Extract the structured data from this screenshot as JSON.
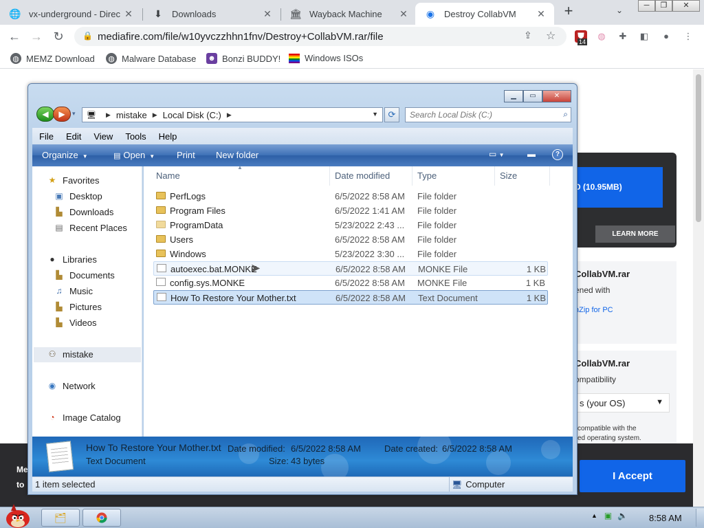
{
  "browser": {
    "tabs": [
      {
        "label": "vx-underground - Direc",
        "icon": "globe-icon",
        "active": false
      },
      {
        "label": "Downloads",
        "icon": "download-icon",
        "active": false
      },
      {
        "label": "Wayback Machine",
        "icon": "archive-icon",
        "active": false
      },
      {
        "label": "Destroy CollabVM",
        "icon": "collabvm-icon",
        "active": true
      }
    ],
    "url": "mediafire.com/file/w10yvczzhhn1fnv/Destroy+CollabVM.rar/file",
    "extension_badge": "14",
    "bookmarks": [
      {
        "label": "MEMZ Download",
        "icon": "globe-icon"
      },
      {
        "label": "Malware Database",
        "icon": "globe-icon"
      },
      {
        "label": "Bonzi BUDDY!",
        "icon": "bonzi-icon"
      },
      {
        "label": "Windows ISOs",
        "icon": "rainbow-flag-icon"
      }
    ]
  },
  "webpage": {
    "download_button": "D (10.95MB)",
    "learn_more": "LEARN MORE",
    "box1_title": "CollabVM.rar",
    "box1_line": "ened with",
    "box1_link": "nZip for PC",
    "box2_title": "CollabVM.rar",
    "box2_line": "ompatibility",
    "os_select": "s (your OS)",
    "compat_note_1": "compatible with the",
    "compat_note_2": "ed operating system.",
    "cookie_text_1": "Me",
    "cookie_text_2": "to",
    "accept": "I Accept"
  },
  "explorer": {
    "breadcrumb": [
      "mistake",
      "Local Disk (C:)"
    ],
    "search_placeholder": "Search Local Disk (C:)",
    "menu": [
      "File",
      "Edit",
      "View",
      "Tools",
      "Help"
    ],
    "commands": {
      "organize": "Organize",
      "open": "Open",
      "print": "Print",
      "new_folder": "New folder"
    },
    "nav": {
      "favorites": "Favorites",
      "favorites_items": [
        "Desktop",
        "Downloads",
        "Recent Places"
      ],
      "libraries": "Libraries",
      "libraries_items": [
        "Documents",
        "Music",
        "Pictures",
        "Videos"
      ],
      "homegroup": "mistake",
      "network": "Network",
      "image_catalog": "Image Catalog"
    },
    "columns": {
      "name": "Name",
      "date": "Date modified",
      "type": "Type",
      "size": "Size"
    },
    "files": [
      {
        "name": "PerfLogs",
        "date": "6/5/2022 8:58 AM",
        "type": "File folder",
        "size": "",
        "kind": "folder"
      },
      {
        "name": "Program Files",
        "date": "6/5/2022 1:41 AM",
        "type": "File folder",
        "size": "",
        "kind": "folder"
      },
      {
        "name": "ProgramData",
        "date": "5/23/2022 2:43 ...",
        "type": "File folder",
        "size": "",
        "kind": "folder"
      },
      {
        "name": "Users",
        "date": "6/5/2022 8:58 AM",
        "type": "File folder",
        "size": "",
        "kind": "folder"
      },
      {
        "name": "Windows",
        "date": "5/23/2022 3:30 ...",
        "type": "File folder",
        "size": "",
        "kind": "folder"
      },
      {
        "name": "autoexec.bat.MONKE",
        "date": "6/5/2022 8:58 AM",
        "type": "MONKE File",
        "size": "1 KB",
        "kind": "file"
      },
      {
        "name": "config.sys.MONKE",
        "date": "6/5/2022 8:58 AM",
        "type": "MONKE File",
        "size": "1 KB",
        "kind": "file"
      },
      {
        "name": "How To Restore Your Mother.txt",
        "date": "6/5/2022 8:58 AM",
        "type": "Text Document",
        "size": "1 KB",
        "kind": "file"
      }
    ],
    "details": {
      "filename": "How To Restore Your Mother.txt",
      "filetype": "Text Document",
      "modified_label": "Date modified:",
      "modified": "6/5/2022 8:58 AM",
      "size_label": "Size:",
      "size": "43 bytes",
      "created_label": "Date created:",
      "created": "6/5/2022 8:58 AM"
    },
    "status_left": "1 item selected",
    "status_right": "Computer"
  },
  "taskbar": {
    "clock": "8:58 AM"
  }
}
